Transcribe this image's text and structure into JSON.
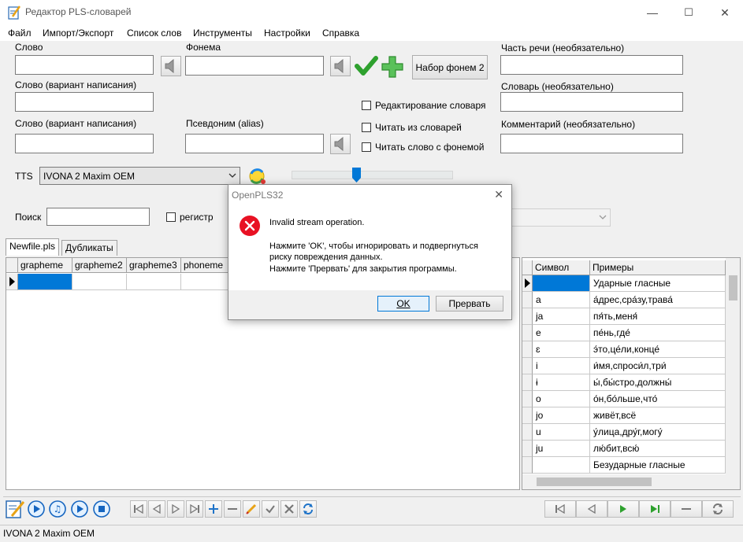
{
  "window": {
    "title": "Редактор PLS-словарей",
    "min": "—",
    "max": "☐",
    "close": "✕"
  },
  "menu": [
    "Файл",
    "Импорт/Экспорт",
    "Список слов",
    "Инструменты",
    "Настройки",
    "Справка"
  ],
  "form": {
    "word_label": "Слово",
    "word_value": "",
    "phoneme_label": "Фонема",
    "phoneme_value": "",
    "phoneme_set_button": "Набор фонем 2",
    "part_of_speech_label": "Часть речи (необязательно)",
    "part_of_speech_value": "",
    "variant1_label": "Слово (вариант написания)",
    "variant1_value": "",
    "dictionary_label": "Словарь (необязательно)",
    "dictionary_value": "",
    "variant2_label": "Слово (вариант написания)",
    "variant2_value": "",
    "alias_label": "Псевдоним (alias)",
    "alias_value": "",
    "comment_label": "Комментарий (необязательно)",
    "comment_value": "",
    "edit_dict_label": "Редактирование словаря",
    "read_dicts_label": "Читать из словарей",
    "read_with_phoneme_label": "Читать слово с фонемой",
    "tts_label": "TTS",
    "tts_value": "IVONA 2 Maxim OEM",
    "speed_slider": 0.4
  },
  "search": {
    "label": "Поиск",
    "value": "",
    "case_label": "регистр"
  },
  "tabs": [
    "Newfile.pls",
    "Дубликаты"
  ],
  "word_grid": {
    "columns": [
      "grapheme",
      "grapheme2",
      "grapheme3",
      "phoneme"
    ]
  },
  "phoneme_table": {
    "columns": [
      "Символ",
      "Примеры"
    ],
    "rows": [
      [
        "",
        "Ударные гласные"
      ],
      [
        "a",
        "а́дрес,сра́зу,трава́"
      ],
      [
        "ja",
        "пя́ть,меня́"
      ],
      [
        "e",
        "пе́нь,где́"
      ],
      [
        "ɛ",
        "э́то,це́ли,конце́"
      ],
      [
        "i",
        "и́мя,спроси́л,три́"
      ],
      [
        "ɨ",
        "ы́,бы́стро,должны́"
      ],
      [
        "o",
        "о́н,бо́льше,что́"
      ],
      [
        "jo",
        "живёт,всё"
      ],
      [
        "u",
        "у́лица,дру́г,могу́"
      ],
      [
        "ju",
        "лю́бит,всю́"
      ],
      [
        "",
        "Безударные гласные"
      ]
    ]
  },
  "status": {
    "text": "IVONA 2 Maxim OEM"
  },
  "dialog": {
    "title": "OpenPLS32",
    "close": "✕",
    "message": "Invalid stream operation.",
    "line1": "Нажмите 'OK', чтобы игнорировать и подвергнуться",
    "line2": "риску повреждения данных.",
    "line3": "Нажмите 'Прервать' для закрытия программы.",
    "ok_button": "OK",
    "abort_button": "Прервать"
  },
  "colors": {
    "selection": "#0078d7",
    "error_red": "#e81123",
    "check_green": "#2ea12e"
  }
}
